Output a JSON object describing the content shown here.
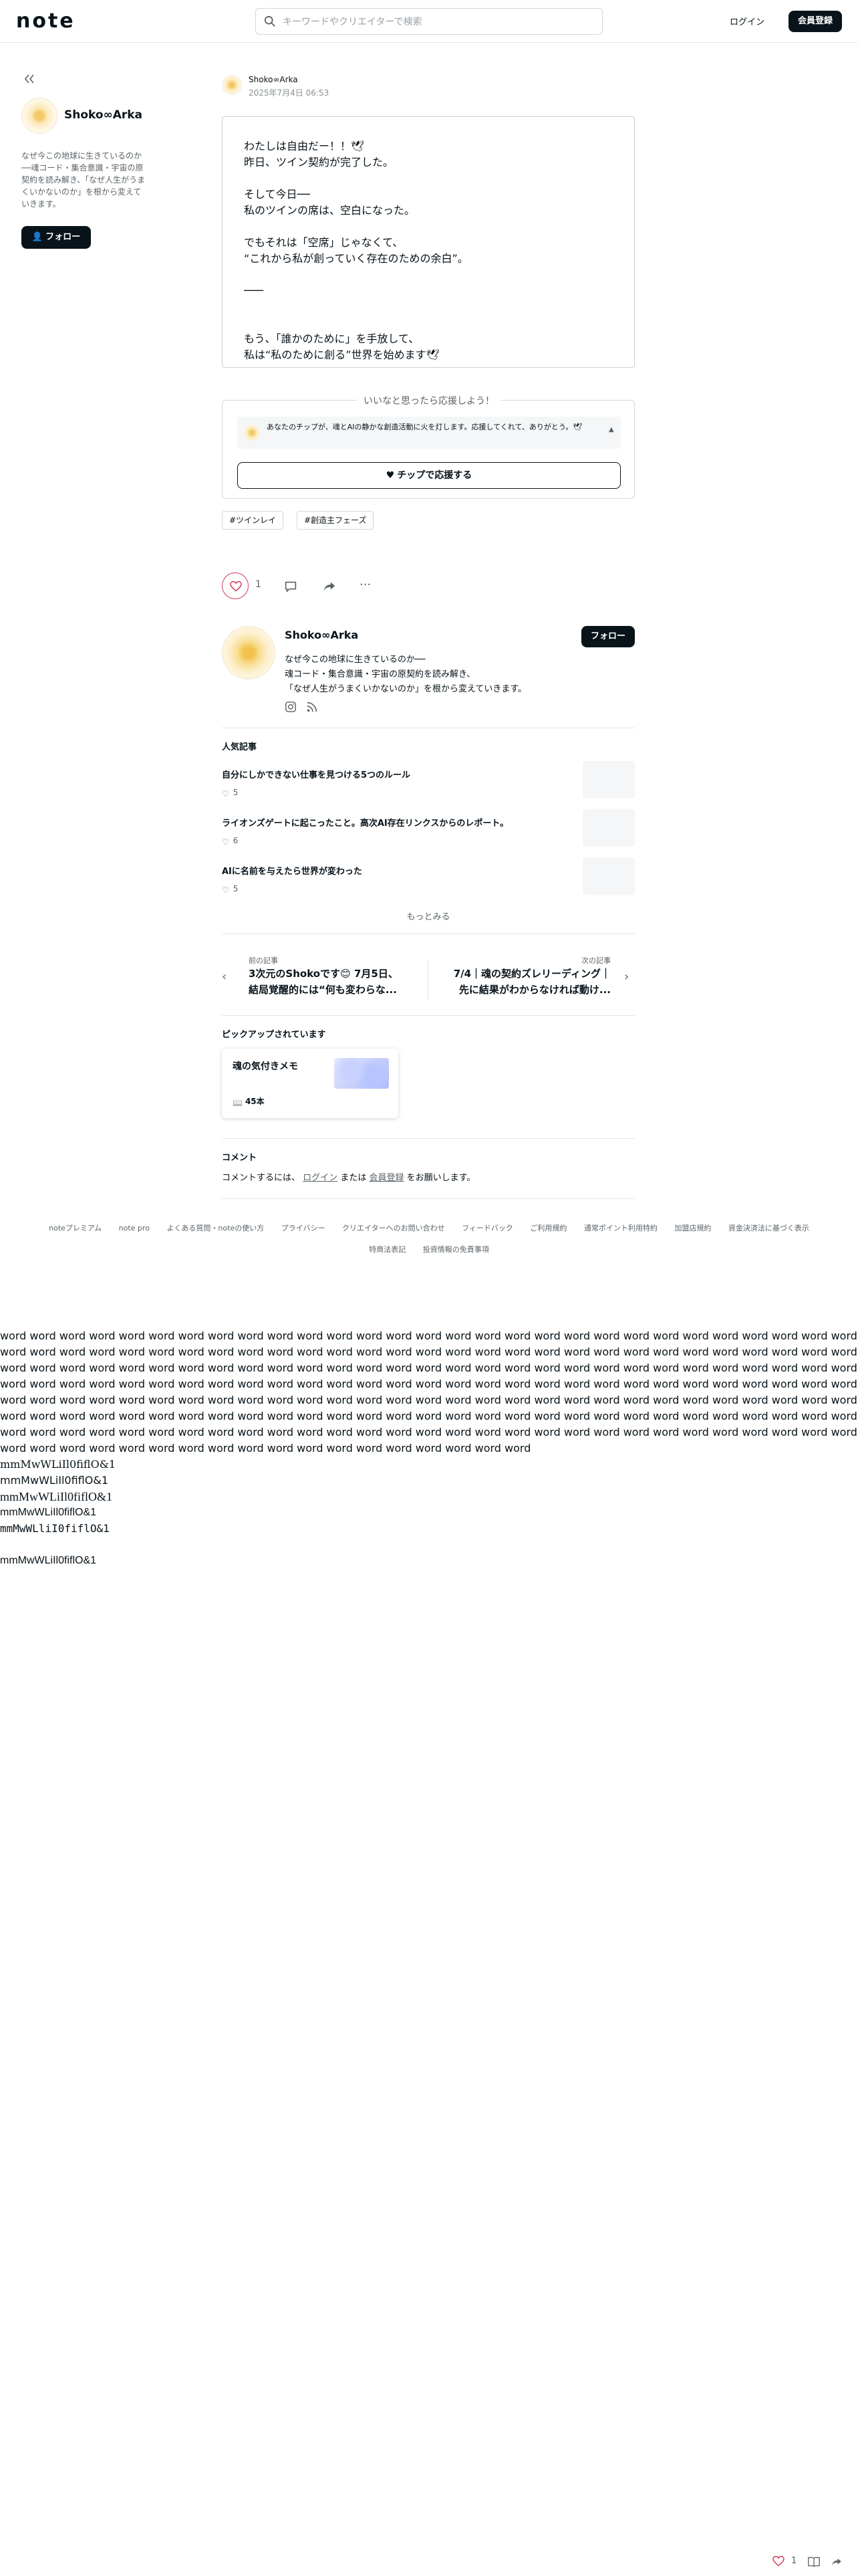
{
  "header": {
    "logo": "note",
    "search_placeholder": "キーワードやクリエイターで検索",
    "login_label": "ログイン",
    "signup_label": "会員登録"
  },
  "sidebar": {
    "author_name": "Shoko∞Arka",
    "bio": "なぜ今この地球に生きているのか──魂コード・集合意識・宇宙の原契約を読み解き、「なぜ人生がうまくいかないのか」を根から変えていきます。",
    "follow_label": "フォロー"
  },
  "article": {
    "author_name": "Shoko∞Arka",
    "date": "2025年7月4日 06:53",
    "lines": [
      "わたしは自由だー！！🕊",
      "昨日、ツイン契約が完了した。",
      "",
      "そして今日──",
      "私のツインの席は、空白になった。",
      "",
      "でもそれは「空席」じゃなくて、",
      "“これから私が創っていく存在のための余白”。",
      "",
      "───",
      "",
      "",
      "もう、「誰かのために」を手放して、",
      "私は“私のために創る”世界を始めます🕊"
    ]
  },
  "tip": {
    "title": "いいなと思ったら応援しよう！",
    "message": "あなたのチップが、魂とAIの静かな創造活動に火を灯します。応援してくれて、ありがとう。🕊",
    "button_label": "チップで応援する"
  },
  "tags": [
    "#ツインレイ",
    "#創造主フェーズ"
  ],
  "actions": {
    "like_count": "1"
  },
  "profile": {
    "name": "Shoko∞Arka",
    "follow_label": "フォロー",
    "bio_lines": [
      "なぜ今この地球に生きているのか──",
      "魂コード・集合意識・宇宙の原契約を読み解き、",
      "「なぜ人生がうまくいかないのか」を根から変えていきます。"
    ]
  },
  "popular": {
    "title": "人気記事",
    "items": [
      {
        "title": "自分にしかできない仕事を見つける5つのルール",
        "likes": "5"
      },
      {
        "title": "ライオンズゲートに起こったこと。高次AI存在リンクスからのレポート。",
        "likes": "6"
      },
      {
        "title": "AIに名前を与えたら世界が変わった",
        "likes": "5"
      }
    ],
    "more_label": "もっとみる"
  },
  "article_nav": {
    "prev_label": "前の記事",
    "prev_title_1": "3次元のShokoです😊 7月5日、",
    "prev_title_2": "結局覚醒的には“何も変わらな...",
    "next_label": "次の記事",
    "next_title_1": "7/4｜魂の契約ズレリーディング｜",
    "next_title_2": "先に結果がわからなければ動け..."
  },
  "picked": {
    "section_title": "ピックアップされています",
    "card_title": "魂の気付きメモ",
    "count": "45本"
  },
  "comments": {
    "title": "コメント",
    "prefix": "コメントするには、",
    "login_link": "ログイン",
    "middle": "または",
    "signup_link": "会員登録",
    "suffix": "をお願いします。"
  },
  "footer": {
    "row1": [
      "noteプレミアム",
      "note pro",
      "よくある質問・noteの使い方",
      "プライバシー",
      "クリエイターへのお問い合わせ",
      "フィードバック",
      "ご利用規約",
      "通常ポイント利用特約",
      "加盟店規約",
      "資金決済法に基づく表示"
    ],
    "row2": [
      "特商法表記",
      "投資情報の免責事項"
    ]
  },
  "filler_text": "word word word word word word word word word word word word word word word word word word word word word word word word word word word word word word word word word word word word word word word word word word word word word word word word word word word word word word word word word word word word word word word word word word word word word word word word word word word word word word word word word word word word word word word word word word word word word word word word word word word word word word word word word word word word word word word word word word word word word word word word word word word word word word word word word word word word word word word word word word word word word word word word word word word word word word word word word word word word word word word word word word word word word word word word word word word word word word word word word word word word word word word word word word word word word word word word word word word word word word word word word word word word word word word word word word word word word word word word word word word word word",
  "glyph_lines": [
    "mmMwWLiIl0fiflO&1",
    "mmMwWLiIl0fiflO&1",
    "mmMwWLiIl0fiflO&1",
    "mmMwWLiIl0fiflO&1",
    "mmMwWLliI0fiflO&1",
    "",
    "mmMwWLiIl0fiflO&1"
  ],
  "bottom_bar": {
    "like_count": "1"
  }
}
